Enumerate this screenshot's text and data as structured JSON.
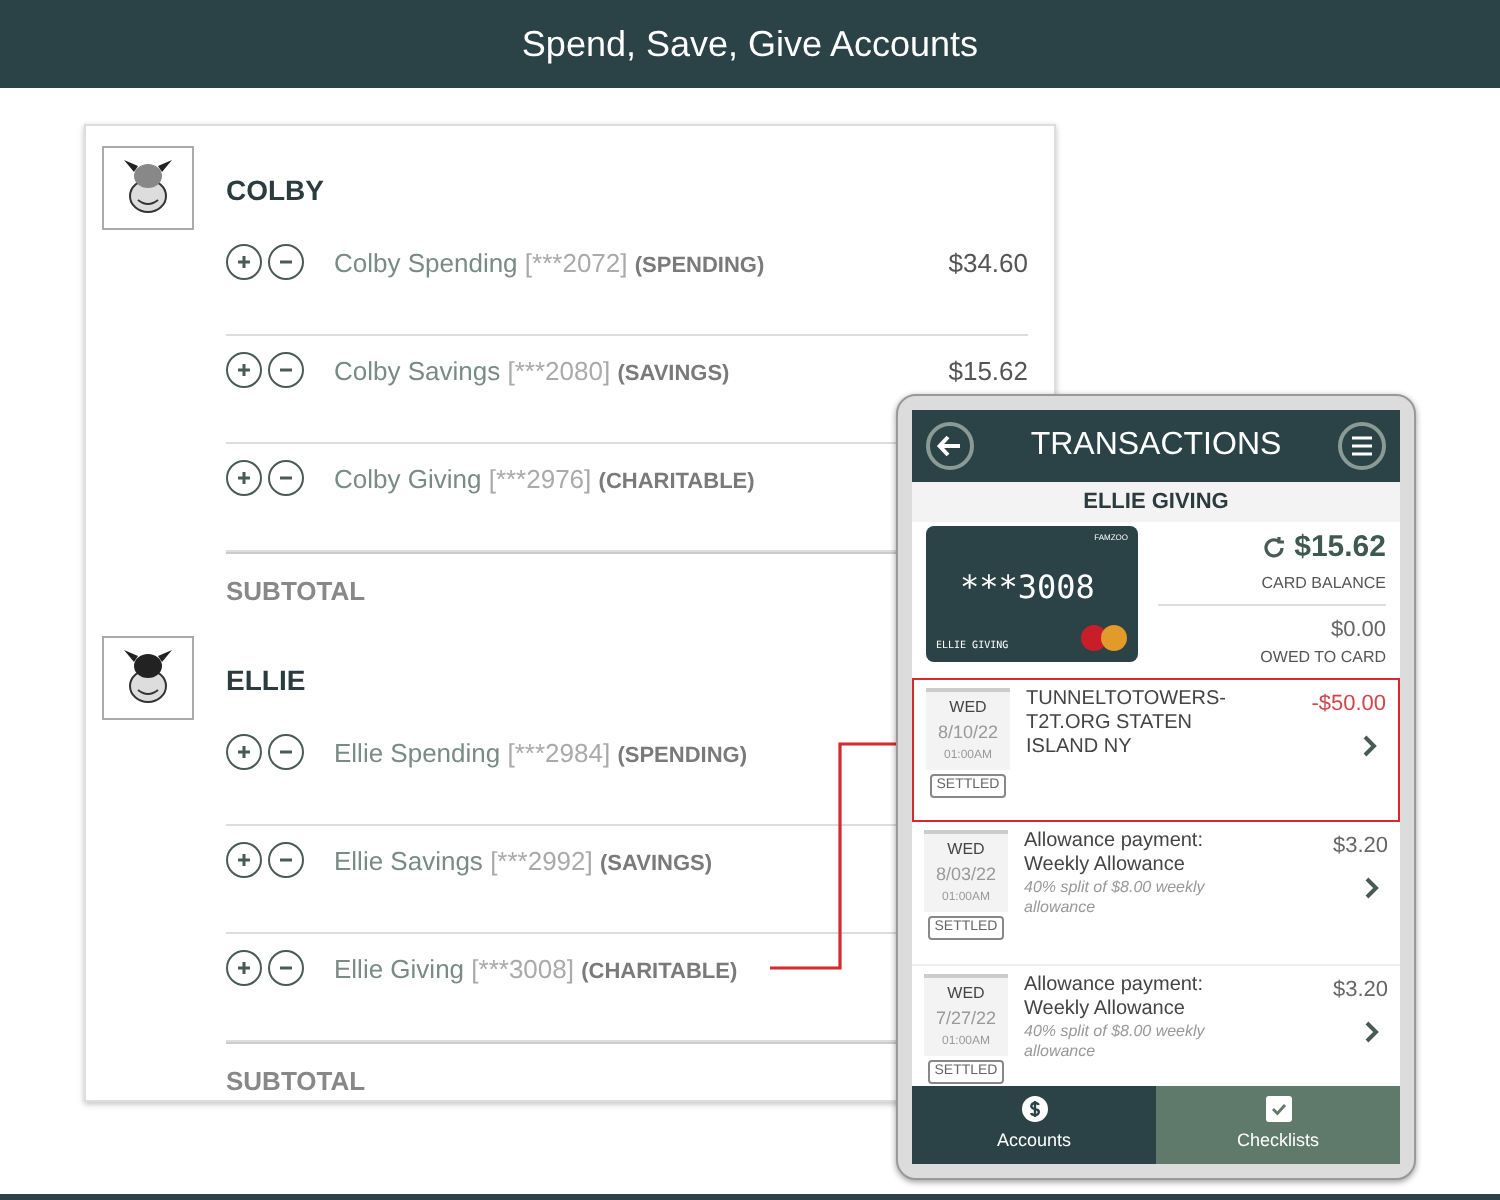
{
  "header": {
    "title": "Spend, Save, Give Accounts"
  },
  "people": [
    {
      "name": "COLBY",
      "accounts": [
        {
          "name": "Colby Spending",
          "number": "[***2072]",
          "type": "(SPENDING)",
          "amount": "$34.60"
        },
        {
          "name": "Colby Savings",
          "number": "[***2080]",
          "type": "(SAVINGS)",
          "amount": "$15.62"
        },
        {
          "name": "Colby Giving",
          "number": "[***2976]",
          "type": "(CHARITABLE)"
        }
      ],
      "subtotal": "SUBTOTAL"
    },
    {
      "name": "ELLIE",
      "accounts": [
        {
          "name": "Ellie Spending",
          "number": "[***2984]",
          "type": "(SPENDING)"
        },
        {
          "name": "Ellie Savings",
          "number": "[***2992]",
          "type": "(SAVINGS)"
        },
        {
          "name": "Ellie Giving",
          "number": "[***3008]",
          "type": "(CHARITABLE)"
        }
      ],
      "subtotal": "SUBTOTAL"
    }
  ],
  "phone": {
    "title": "TRANSACTIONS",
    "account_name": "ELLIE GIVING",
    "card": {
      "brand": "FAMZOO",
      "number": "***3008",
      "holder": "ELLIE GIVING"
    },
    "balance": "$15.62",
    "balance_label": "CARD BALANCE",
    "owed": "$0.00",
    "owed_label": "OWED TO CARD",
    "transactions": [
      {
        "day": "WED",
        "date": "8/10/22",
        "time": "01:00AM",
        "status": "SETTLED",
        "title": "TUNNELTOTOWERS-T2T.ORG STATEN ISLAND NY",
        "amount": "-$50.00",
        "kind": "debit",
        "selected": true
      },
      {
        "day": "WED",
        "date": "8/03/22",
        "time": "01:00AM",
        "status": "SETTLED",
        "title": "Allowance payment: Weekly Allowance",
        "note": "40% split of $8.00 weekly allowance",
        "amount": "$3.20",
        "kind": "credit",
        "selected": false
      },
      {
        "day": "WED",
        "date": "7/27/22",
        "time": "01:00AM",
        "status": "SETTLED",
        "title": "Allowance payment: Weekly Allowance",
        "note": "40% split of $8.00 weekly allowance",
        "amount": "$3.20",
        "kind": "credit",
        "selected": false
      }
    ],
    "tabs": [
      {
        "label": "Accounts",
        "kind": "accounts",
        "selected": true
      },
      {
        "label": "Checklists",
        "kind": "checklists",
        "selected": false
      }
    ]
  }
}
